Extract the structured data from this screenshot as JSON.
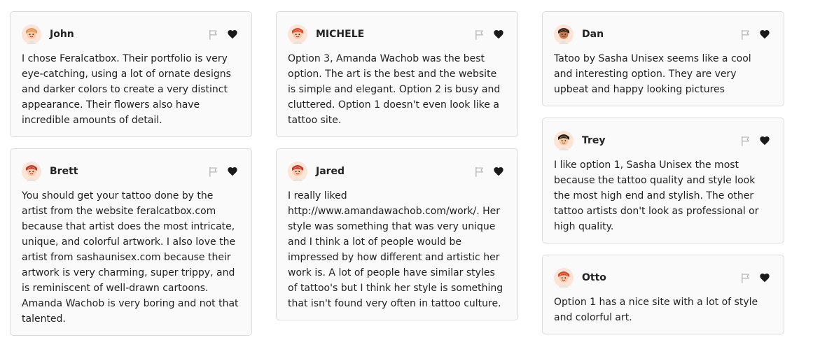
{
  "columns": [
    {
      "cards": [
        {
          "name": "John",
          "hair": "#e39a57",
          "skin": "#f6c8a8",
          "text": "I chose Feralcatbox. Their portfolio is very eye-catching, using a lot of ornate designs and darker colors to create a very distinct appearance. Their flowers also have incredible amounts of detail."
        },
        {
          "name": "Brett",
          "hair": "#c0392b",
          "skin": "#f6c8a8",
          "text": "You should get your tattoo done by the artist from the website feralcatbox.com because that artist does the most intricate, unique, and colorful artwork. I also love the artist from sashaunisex.com because their artwork is very charming, super trippy, and is reminiscent of well-drawn cartoons. Amanda Wachob is very boring and not that talented."
        }
      ]
    },
    {
      "cards": [
        {
          "name": "MICHELE",
          "hair": "#d9482b",
          "skin": "#f6c8a8",
          "text": "Option 3, Amanda Wachob was the best option. The art is the best and the website is simple and elegant. Option 2 is busy and cluttered. Option 1 doesn't even look like a tattoo site."
        },
        {
          "name": "Jared",
          "hair": "#c0392b",
          "skin": "#f6c8a8",
          "text": "I really liked http://www.amandawachob.com/work/. Her style was something that was very unique and I think a lot of people would be impressed by how different and artistic her work is. A lot of people have similar styles of tattoo's but I think her style is something that isn't found very often in tattoo culture."
        }
      ]
    },
    {
      "cards": [
        {
          "name": "Dan",
          "hair": "#3b2418",
          "skin": "#c47a4e",
          "text": "Tatoo by Sasha Unisex seems like a cool and interesting option. They are very upbeat and happy looking pictures"
        },
        {
          "name": "Trey",
          "hair": "#2a1d14",
          "skin": "#f3c9a0",
          "text": "I like option 1, Sasha Unisex the most because the tattoo quality and style look the most high end and stylish. The other tattoo artists don't look as professional or high quality."
        },
        {
          "name": "Otto",
          "hair": "#d9482b",
          "skin": "#f6c8a8",
          "text": "Option 1 has a nice site with a lot of style and colorful art."
        }
      ]
    }
  ],
  "icons": {
    "avatar": "avatar-icon",
    "flag": "flag-icon",
    "like": "heart-icon"
  },
  "colors": {
    "card_bg": "#fafafa",
    "card_border": "#dcdcdc",
    "flag": "#b5b5b5",
    "heart": "#1a1a1a",
    "text": "#1f1f1f"
  }
}
